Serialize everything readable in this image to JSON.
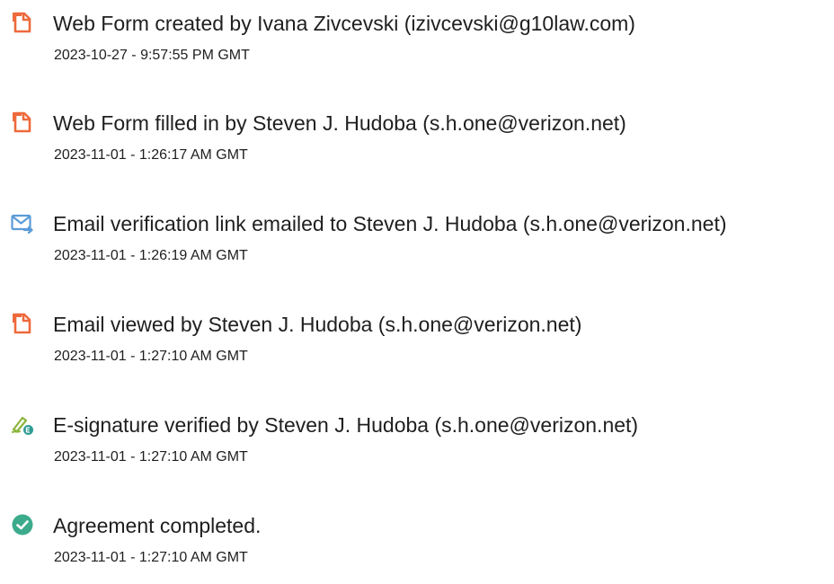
{
  "colors": {
    "document_icon": "#ee6a3c",
    "email_icon": "#5b9bd8",
    "signature_pen": "#8cb53c",
    "signature_badge": "#2f9b93",
    "check_icon": "#3cab8c"
  },
  "events": [
    {
      "icon": "document-icon",
      "description": "Web Form created by Ivana Zivcevski (izivcevski@g10law.com)",
      "timestamp": "2023-10-27 - 9:57:55 PM GMT"
    },
    {
      "icon": "document-icon",
      "description": "Web Form filled in by Steven J. Hudoba (s.h.one@verizon.net)",
      "timestamp": "2023-11-01 - 1:26:17 AM GMT"
    },
    {
      "icon": "email-sent-icon",
      "description": "Email verification link emailed to Steven J. Hudoba (s.h.one@verizon.net)",
      "timestamp": "2023-11-01 - 1:26:19 AM GMT"
    },
    {
      "icon": "document-icon",
      "description": "Email viewed by Steven J. Hudoba (s.h.one@verizon.net)",
      "timestamp": "2023-11-01 - 1:27:10 AM GMT"
    },
    {
      "icon": "e-signature-icon",
      "description": "E-signature verified by Steven J. Hudoba (s.h.one@verizon.net)",
      "timestamp": "2023-11-01 - 1:27:10 AM GMT"
    },
    {
      "icon": "check-circle-icon",
      "description": "Agreement completed.",
      "timestamp": "2023-11-01 - 1:27:10 AM GMT"
    }
  ]
}
